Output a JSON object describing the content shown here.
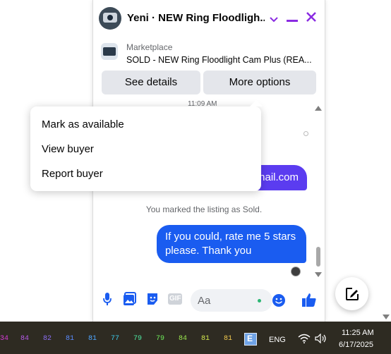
{
  "chat": {
    "title": "Yeni · NEW Ring Floodligh...",
    "listing_category": "Marketplace",
    "listing_title": "SOLD - NEW Ring Floodlight Cam Plus (REA...",
    "see_details": "See details",
    "more_options": "More options",
    "partial_top_text": "11:09 AM",
    "email_fragment": "nail.com",
    "system_message": "You marked the listing as Sold.",
    "last_message": "If you could, rate me 5 stars please. Thank you",
    "input_placeholder": "Aa",
    "gif_label": "GIF"
  },
  "menu": {
    "items": [
      {
        "label": "Mark as available"
      },
      {
        "label": "View buyer"
      },
      {
        "label": "Report buyer"
      }
    ]
  },
  "taskbar": {
    "numbers": [
      {
        "text": "34",
        "color": "#d63cd6"
      },
      {
        "text": "84",
        "color": "#b45ae6"
      },
      {
        "text": "82",
        "color": "#8a6ef0"
      },
      {
        "text": "81",
        "color": "#5a8cff"
      },
      {
        "text": "81",
        "color": "#4ea6ff"
      },
      {
        "text": "77",
        "color": "#3cc8e6"
      },
      {
        "text": "79",
        "color": "#4ee6a0"
      },
      {
        "text": "79",
        "color": "#6eea5a"
      },
      {
        "text": "84",
        "color": "#9ae64e"
      },
      {
        "text": "81",
        "color": "#d2e64e"
      },
      {
        "text": "81",
        "color": "#f0c84e"
      }
    ],
    "language": "ENG",
    "time": "11:25 AM",
    "date": "6/17/2025"
  },
  "colors": {
    "accent_purple": "#8a2be2",
    "messenger_blue": "#1a5cf0",
    "email_bubble": "#5b3cf0"
  },
  "icons": {
    "header": [
      "chevron-down-icon",
      "minimize-icon",
      "close-icon"
    ],
    "composer": [
      "microphone-icon",
      "photo-icon",
      "sticker-icon",
      "gif-icon",
      "emoji-icon",
      "like-icon"
    ],
    "taskbar": [
      "app-icon",
      "wifi-icon",
      "volume-icon"
    ],
    "compose": "compose-icon"
  }
}
